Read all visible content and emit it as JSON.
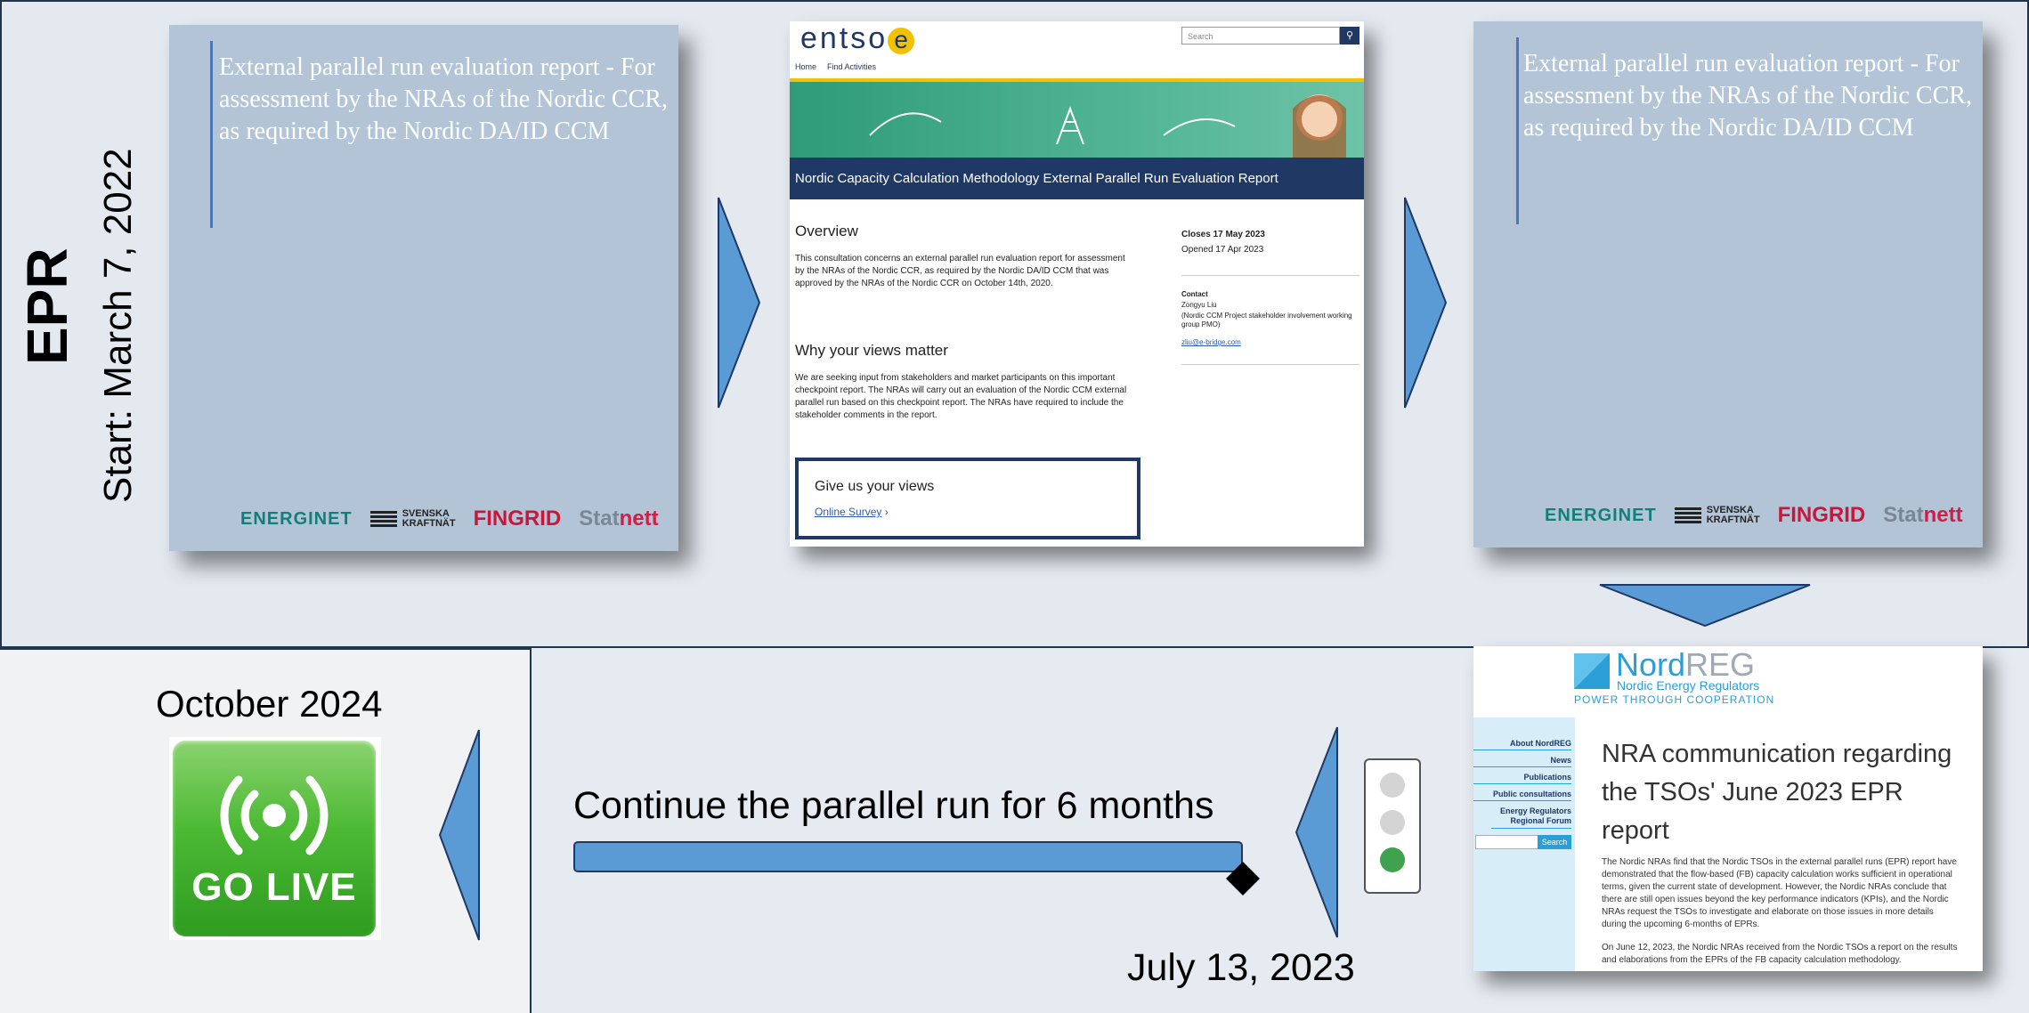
{
  "phase": {
    "label": "EPR",
    "start": "Start: March 7, 2022"
  },
  "report_card": {
    "title": "External parallel run evaluation report - For assessment by the NRAs of the Nordic CCR, as required by the Nordic DA/ID CCM",
    "logos": {
      "energinet": "ENERGINET",
      "svenska": "SVENSKA",
      "kraftnat": "KRAFTNÄT",
      "fingrid": "FINGRID",
      "statnett_a": "Stat",
      "statnett_b": "nett"
    }
  },
  "entsoe": {
    "logo_a": "entso",
    "logo_b": "e",
    "search_placeholder": "Search",
    "nav": [
      "Home",
      "Find Activities"
    ],
    "banner_title": "Nordic Capacity Calculation Methodology External Parallel Run Evaluation Report",
    "overview_h": "Overview",
    "overview_p": "This consultation concerns an external parallel run evaluation report for assessment by the NRAs of the Nordic CCR, as required by the Nordic DA/ID CCM that was approved by the NRAs of the Nordic CCR on October 14th, 2020.",
    "why_h": "Why your views matter",
    "why_p": "We are seeking input from stakeholders and market participants on this important checkpoint report. The NRAs will carry out an evaluation of the Nordic CCM external parallel run based on this checkpoint report. The NRAs have required to include the stakeholder comments in the report.",
    "closes": "Closes 17 May 2023",
    "opened": "Opened 17 Apr 2023",
    "contact_h": "Contact",
    "contact_name": "Zongyu Liu",
    "contact_org": "(Nordic CCM Project stakeholder involvement working group PMO)",
    "contact_mail": "zliu@e-bridge.com",
    "give_views": "Give us your views",
    "survey_link": "Online Survey"
  },
  "nordreg": {
    "logo_a": "Nord",
    "logo_b": "REG",
    "sub": "Nordic Energy Regulators",
    "tagline": "POWER THROUGH COOPERATION",
    "menu": [
      "About NordREG",
      "News",
      "Publications",
      "Public consultations",
      "Energy Regulators Regional Forum"
    ],
    "search_btn": "Search",
    "heading": "NRA communication regarding the TSOs' June 2023 EPR report",
    "p1": "The Nordic NRAs find that the Nordic TSOs in the external parallel runs (EPR) report have demonstrated that the flow-based (FB) capacity calculation works sufficient in operational terms, given the current state of development. However, the Nordic NRAs conclude that there are still open issues beyond the key performance indicators (KPIs), and the Nordic NRAs request the TSOs to investigate and elaborate on those issues in more details during the upcoming 6-months of EPRs.",
    "p2": "On June 12, 2023, the Nordic NRAs received from the Nordic TSOs a report on the results and elaborations from the EPRs of the FB capacity calculation methodology."
  },
  "timeline": {
    "continue_label": "Continue the parallel run for 6 months",
    "milestone_date": "July 13, 2023",
    "golive_date": "October 2024",
    "golive_label": "GO LIVE"
  },
  "colors": {
    "arrow": "#5b9bd5",
    "dark_navy": "#1f3864",
    "card": "#b3c4d6",
    "go_green": "#3fae2a"
  }
}
